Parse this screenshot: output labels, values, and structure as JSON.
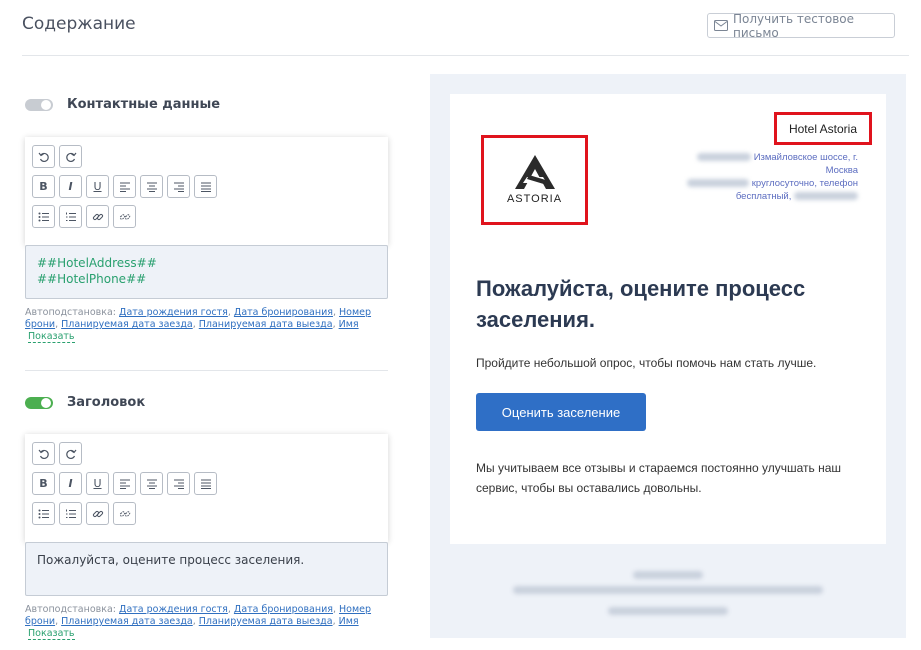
{
  "page": {
    "title": "Содержание"
  },
  "header": {
    "test_email_label": "Получить тестовое письмо"
  },
  "sections": [
    {
      "toggle_on": false,
      "label": "Контактные данные",
      "content_lines": [
        "##HotelAddress##",
        "##HotelPhone##"
      ]
    },
    {
      "toggle_on": true,
      "label": "Заголовок",
      "content_text": "Пожалуйста, оцените процесс заселения."
    }
  ],
  "autosubstitution": {
    "prefix": "Автоподстановка:",
    "links": [
      "Дата рождения гостя",
      "Дата бронирования",
      "Номер брони",
      "Планируемая дата заезда",
      "Планируемая дата выезда",
      "Имя"
    ],
    "show_label": "Показать"
  },
  "toolbar": {
    "icons": [
      "undo-icon",
      "redo-icon",
      "bold-icon",
      "italic-icon",
      "underline-icon",
      "align-left-icon",
      "align-center-icon",
      "align-right-icon",
      "align-justify-icon",
      "bullet-list-icon",
      "numbered-list-icon",
      "link-icon",
      "unlink-icon"
    ],
    "bold": "B",
    "italic": "I",
    "underline": "U"
  },
  "preview": {
    "hotel_name": "Hotel Astoria",
    "logo_text": "ASTORIA",
    "address_line1": "Измайловское шоссе, г.",
    "address_line2": "Москва",
    "address_line3": "круглосуточно, телефон",
    "address_line4": "бесплатный,",
    "heading": "Пожалуйста, оцените процесс заселения.",
    "intro": "Пройдите небольшой опрос, чтобы помочь нам стать лучше.",
    "cta_label": "Оценить заселение",
    "closing": "Мы учитываем все отзывы и стараемся постоянно улучшать наш сервис, чтобы вы оставались довольны."
  },
  "colors": {
    "accent": "#2f6fc6",
    "toggle_on": "#4caf50",
    "highlight_frame": "#e0131d",
    "variable_text": "#29a06f"
  }
}
